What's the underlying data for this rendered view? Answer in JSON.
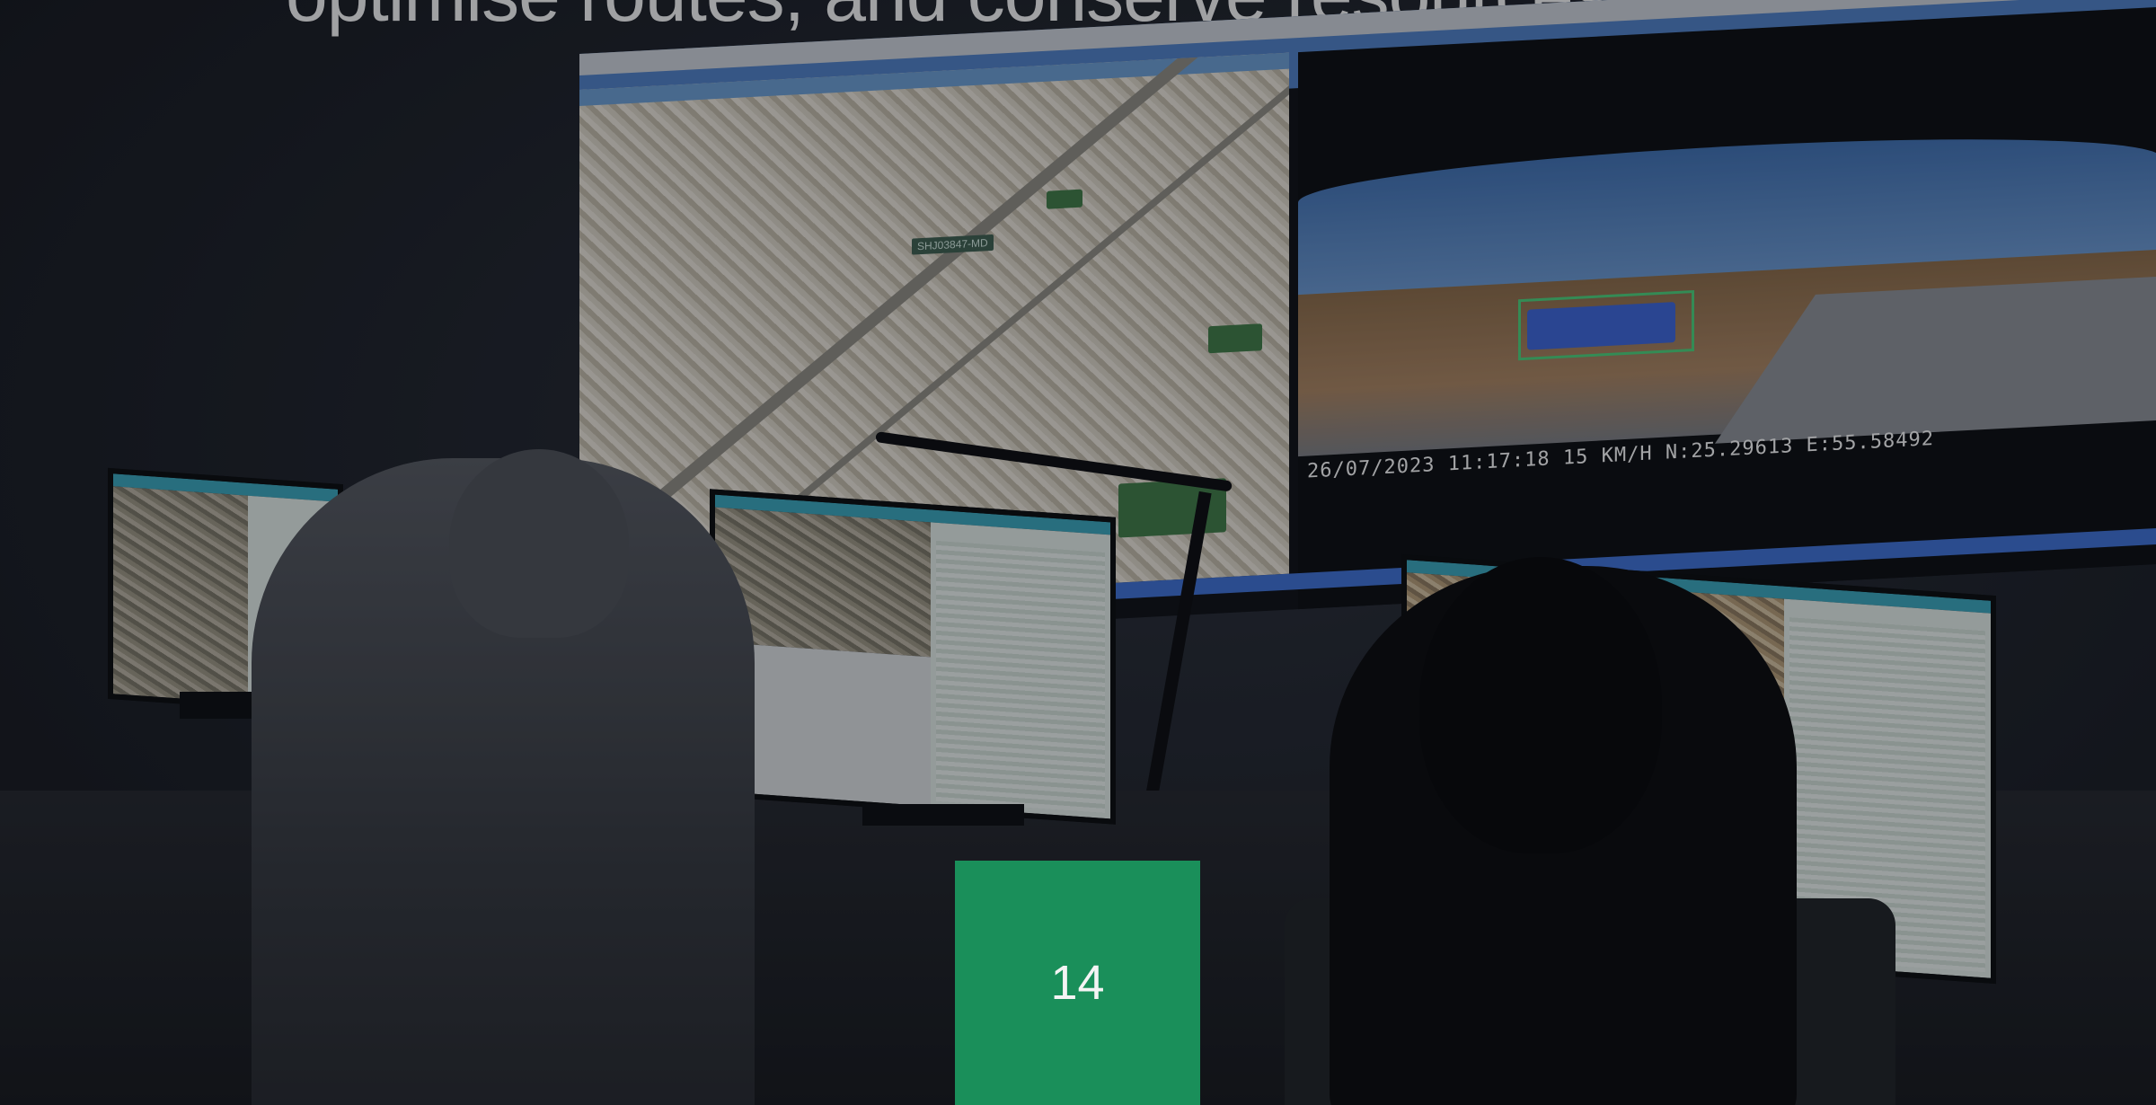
{
  "headline": "optimise routes, and conserve resources.",
  "video_wall": {
    "map_label": "SHJ03847-MD",
    "camera_overlay": "26/07/2023 11:17:18 15 KM/H N:25.29613 E:55.58492"
  },
  "page_number": "14",
  "colors": {
    "page_box": "#1a8f5a",
    "headline": "#f2f2f2",
    "wall_accent": "#4f7fc3"
  }
}
